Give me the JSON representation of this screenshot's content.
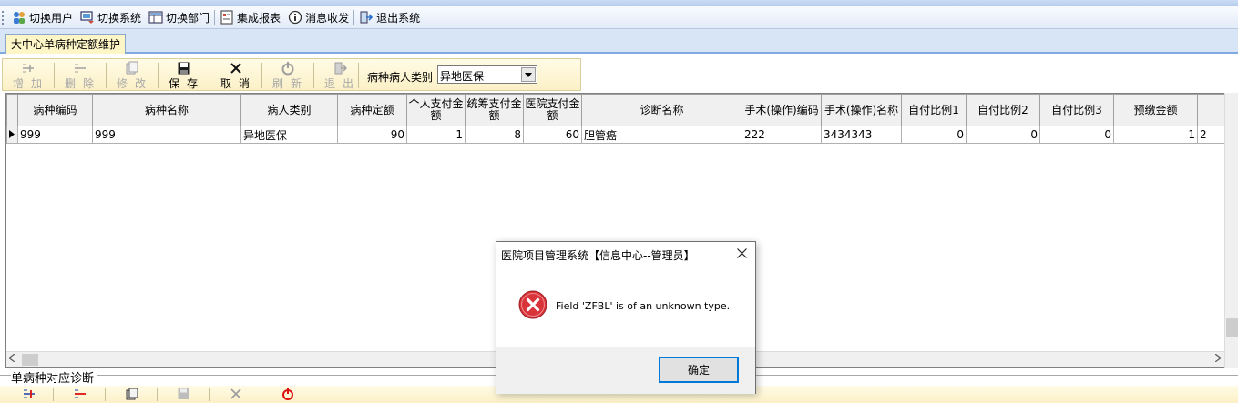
{
  "menubar": {
    "items": [
      {
        "label": "切换用户",
        "icon": "users-icon"
      },
      {
        "label": "切换系统",
        "icon": "switch-system-icon"
      },
      {
        "label": "切换部门",
        "icon": "department-icon"
      },
      {
        "label": "集成报表",
        "icon": "report-icon"
      },
      {
        "label": "消息收发",
        "icon": "info-icon"
      },
      {
        "label": "退出系统",
        "icon": "exit-icon"
      }
    ]
  },
  "tab": {
    "label": "大中心单病种定额维护"
  },
  "toolbar": {
    "add": "增加",
    "delete": "删除",
    "edit": "修改",
    "save": "保存",
    "cancel": "取消",
    "refresh": "刷新",
    "exit": "退出",
    "filter_label": "病种病人类别",
    "filter_value": "异地医保"
  },
  "grid": {
    "columns": [
      "病种编码",
      "病种名称",
      "病人类别",
      "病种定额",
      "个人支付金额",
      "统筹支付金额",
      "医院支付金额",
      "诊断名称",
      "手术(操作)编码",
      "手术(操作)名称",
      "自付比例1",
      "自付比例2",
      "自付比例3",
      "预缴金额"
    ],
    "rows": [
      [
        "999",
        "999",
        "异地医保",
        "90",
        "1",
        "8",
        "60",
        "胆管癌",
        "222",
        "3434343",
        "0",
        "0",
        "0",
        "1",
        "2"
      ]
    ]
  },
  "bottom": {
    "label": "单病种对应诊断"
  },
  "dialog": {
    "title": "医院项目管理系统【信息中心--管理员】",
    "message": "Field 'ZFBL' is of an unknown type.",
    "ok": "确定",
    "icon": "error-icon"
  },
  "colors": {
    "accent": "#0078d7",
    "error": "#d9343a",
    "toolbar_bg": "#fbf0c6",
    "tab_bg": "#fff6c8"
  }
}
